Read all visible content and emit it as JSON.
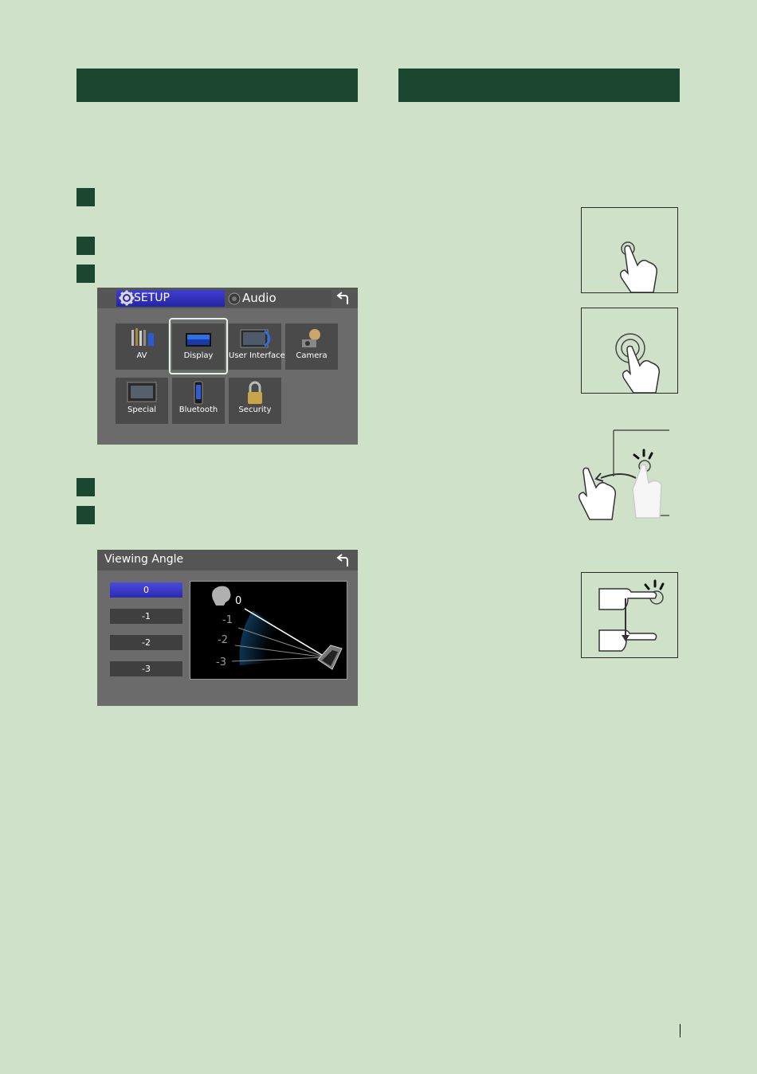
{
  "setup_screen": {
    "tab_setup": "SETUP",
    "tab_audio": "Audio",
    "back_icon": "back-arrow-icon",
    "tiles": [
      {
        "label": "AV",
        "icon": "av-icon"
      },
      {
        "label": "Display",
        "icon": "display-icon"
      },
      {
        "label": "User Interface",
        "icon": "user-interface-icon"
      },
      {
        "label": "Camera",
        "icon": "camera-icon"
      },
      {
        "label": "Special",
        "icon": "special-icon"
      },
      {
        "label": "Bluetooth",
        "icon": "bluetooth-icon"
      },
      {
        "label": "Security",
        "icon": "security-icon"
      }
    ],
    "selected_tile": "Display"
  },
  "viewing_angle_screen": {
    "title": "Viewing Angle",
    "back_icon": "back-arrow-icon",
    "options": [
      "0",
      "-1",
      "-2",
      "-3"
    ],
    "selected": "0",
    "diagram_labels": [
      "0",
      "-1",
      "-2",
      "-3"
    ]
  },
  "colors": {
    "page_bg": "#cfe2c9",
    "header_bar": "#1b4630",
    "selected_tab": "#3333c0"
  }
}
